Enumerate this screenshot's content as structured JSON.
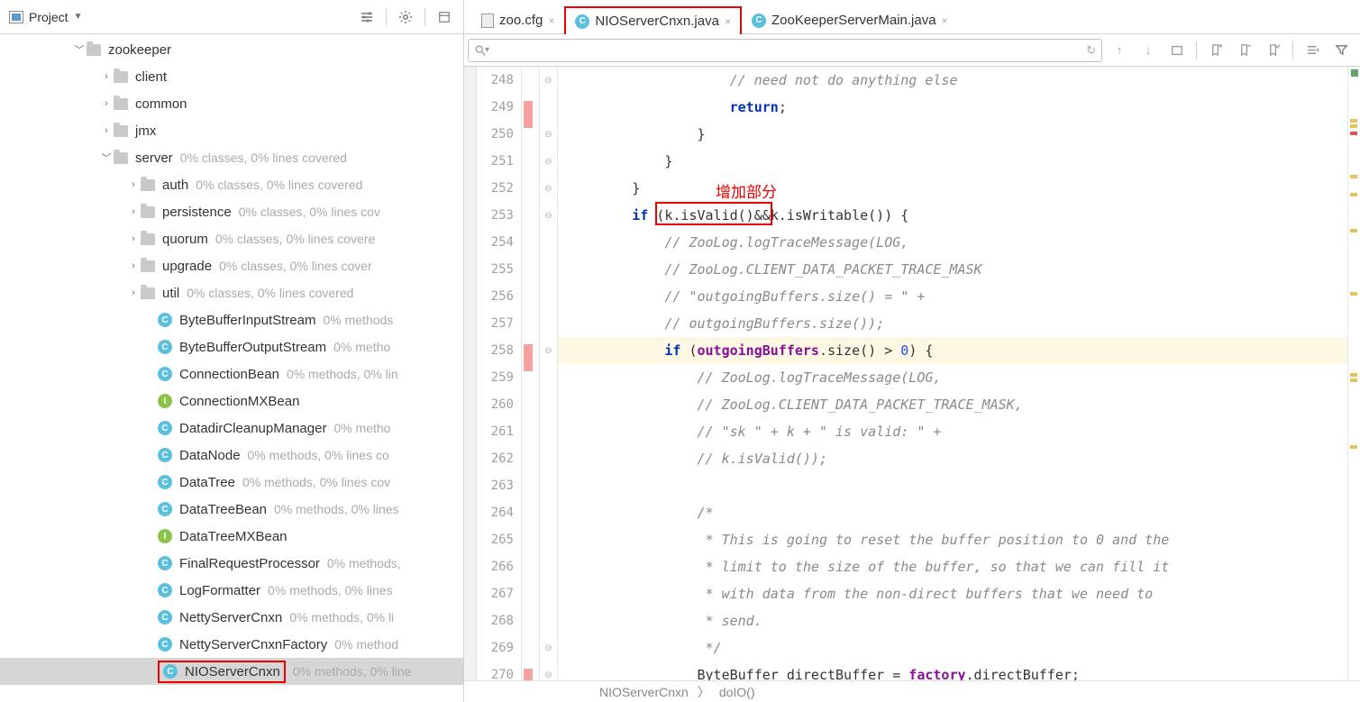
{
  "projectDropdown": {
    "label": "Project"
  },
  "tree": {
    "root": {
      "name": "zookeeper"
    },
    "folders": [
      {
        "name": "client",
        "meta": ""
      },
      {
        "name": "common",
        "meta": ""
      },
      {
        "name": "jmx",
        "meta": ""
      }
    ],
    "server": {
      "name": "server",
      "meta": "0% classes, 0% lines covered"
    },
    "serverSubs": [
      {
        "name": "auth",
        "meta": "0% classes, 0% lines covered"
      },
      {
        "name": "persistence",
        "meta": "0% classes, 0% lines cov"
      },
      {
        "name": "quorum",
        "meta": "0% classes, 0% lines covere"
      },
      {
        "name": "upgrade",
        "meta": "0% classes, 0% lines cover"
      },
      {
        "name": "util",
        "meta": "0% classes, 0% lines covered"
      }
    ],
    "classes": [
      {
        "type": "c",
        "name": "ByteBufferInputStream",
        "meta": "0% methods"
      },
      {
        "type": "c",
        "name": "ByteBufferOutputStream",
        "meta": "0% metho"
      },
      {
        "type": "c",
        "name": "ConnectionBean",
        "meta": "0% methods, 0% lin"
      },
      {
        "type": "i",
        "name": "ConnectionMXBean",
        "meta": ""
      },
      {
        "type": "c",
        "name": "DatadirCleanupManager",
        "meta": "0% metho"
      },
      {
        "type": "c",
        "name": "DataNode",
        "meta": "0% methods, 0% lines co"
      },
      {
        "type": "c",
        "name": "DataTree",
        "meta": "0% methods, 0% lines cov"
      },
      {
        "type": "c",
        "name": "DataTreeBean",
        "meta": "0% methods, 0% lines"
      },
      {
        "type": "i",
        "name": "DataTreeMXBean",
        "meta": ""
      },
      {
        "type": "c",
        "name": "FinalRequestProcessor",
        "meta": "0% methods,"
      },
      {
        "type": "c",
        "name": "LogFormatter",
        "meta": "0% methods, 0% lines"
      },
      {
        "type": "c",
        "name": "NettyServerCnxn",
        "meta": "0% methods, 0% li"
      },
      {
        "type": "c",
        "name": "NettyServerCnxnFactory",
        "meta": "0% method"
      },
      {
        "type": "c",
        "name": "NIOServerCnxn",
        "meta": "0% methods, 0% line",
        "selected": true
      }
    ]
  },
  "tabs": [
    {
      "label": "zoo.cfg",
      "type": "cfg",
      "active": false
    },
    {
      "label": "NIOServerCnxn.java",
      "type": "java",
      "active": true
    },
    {
      "label": "ZooKeeperServerMain.java",
      "type": "java",
      "active": false
    }
  ],
  "lineNumbers": [
    "248",
    "249",
    "250",
    "251",
    "252",
    "253",
    "254",
    "255",
    "256",
    "257",
    "258",
    "259",
    "260",
    "261",
    "262",
    "263",
    "264",
    "265",
    "266",
    "267",
    "268",
    "269",
    "270"
  ],
  "markerRows": [
    1,
    10,
    22
  ],
  "code": {
    "l248": "                    // need not do anything else",
    "l249a": "                    ",
    "l249b": "return",
    "l249c": ";",
    "l250": "                }",
    "l251": "            }",
    "l252": "        }",
    "l253a": "        ",
    "l253b": "if",
    "l253c": " (k.isValid()&&k.isWritable()) {",
    "l254": "            // ZooLog.logTraceMessage(LOG,",
    "l255": "            // ZooLog.CLIENT_DATA_PACKET_TRACE_MASK",
    "l256": "            // \"outgoingBuffers.size() = \" +",
    "l257": "            // outgoingBuffers.size());",
    "l258a": "            ",
    "l258b": "if",
    "l258c": " (",
    "l258d": "outgoingBuffers",
    "l258e": ".size() > ",
    "l258f": "0",
    "l258g": ") {",
    "l259": "                // ZooLog.logTraceMessage(LOG,",
    "l260": "                // ZooLog.CLIENT_DATA_PACKET_TRACE_MASK,",
    "l261": "                // \"sk \" + k + \" is valid: \" +",
    "l262": "                // k.isValid());",
    "l263": "",
    "l264": "                /*",
    "l265": "                 * This is going to reset the buffer position to 0 and the",
    "l266": "                 * limit to the size of the buffer, so that we can fill it",
    "l267": "                 * with data from the non-direct buffers that we need to",
    "l268": "                 * send.",
    "l269": "                 */",
    "l270a": "                ByteBuffer directBuffer = ",
    "l270b": "factory",
    "l270c": ".directBuffer;"
  },
  "annotation": {
    "label": "增加部分"
  },
  "breadcrumb": {
    "class": "NIOServerCnxn",
    "method": "doIO()"
  }
}
